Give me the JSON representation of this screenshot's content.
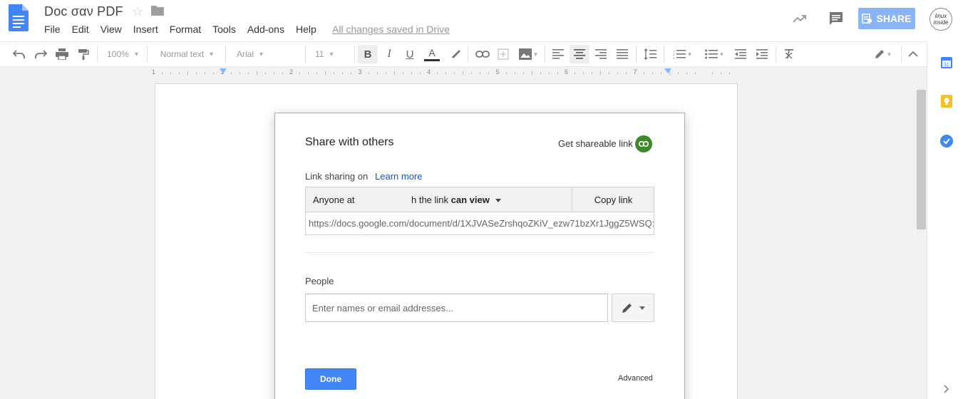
{
  "header": {
    "title": "Doc σαν PDF",
    "menu": [
      "File",
      "Edit",
      "View",
      "Insert",
      "Format",
      "Tools",
      "Add-ons",
      "Help"
    ],
    "saved_status": "All changes saved in Drive",
    "share_label": "SHARE",
    "avatar_text": "linux inside"
  },
  "toolbar": {
    "zoom": "100%",
    "style": "Normal text",
    "font": "Arial",
    "size": "11"
  },
  "ruler": {
    "numbers": [
      "1",
      "1",
      "2",
      "3",
      "4",
      "5",
      "6",
      "7"
    ]
  },
  "dialog": {
    "title": "Share with others",
    "get_link_label": "Get shareable link",
    "link_sharing_label": "Link sharing on",
    "learn_more": "Learn more",
    "anyone_text": "Anyone at",
    "the_link_text": "h the link",
    "can_view": "can view",
    "copy_link": "Copy link",
    "url": "https://docs.google.com/document/d/1XJVASeZrshqoZKiV_ezw71bzXr1JggZ5WSQ:",
    "people_label": "People",
    "people_placeholder": "Enter names or email addresses...",
    "done": "Done",
    "advanced": "Advanced"
  },
  "colors": {
    "accent": "#4285f4",
    "share_btn": "#8ab4f8",
    "link_icon_bg": "#3d8a2a",
    "learn_more": "#1155cc"
  }
}
